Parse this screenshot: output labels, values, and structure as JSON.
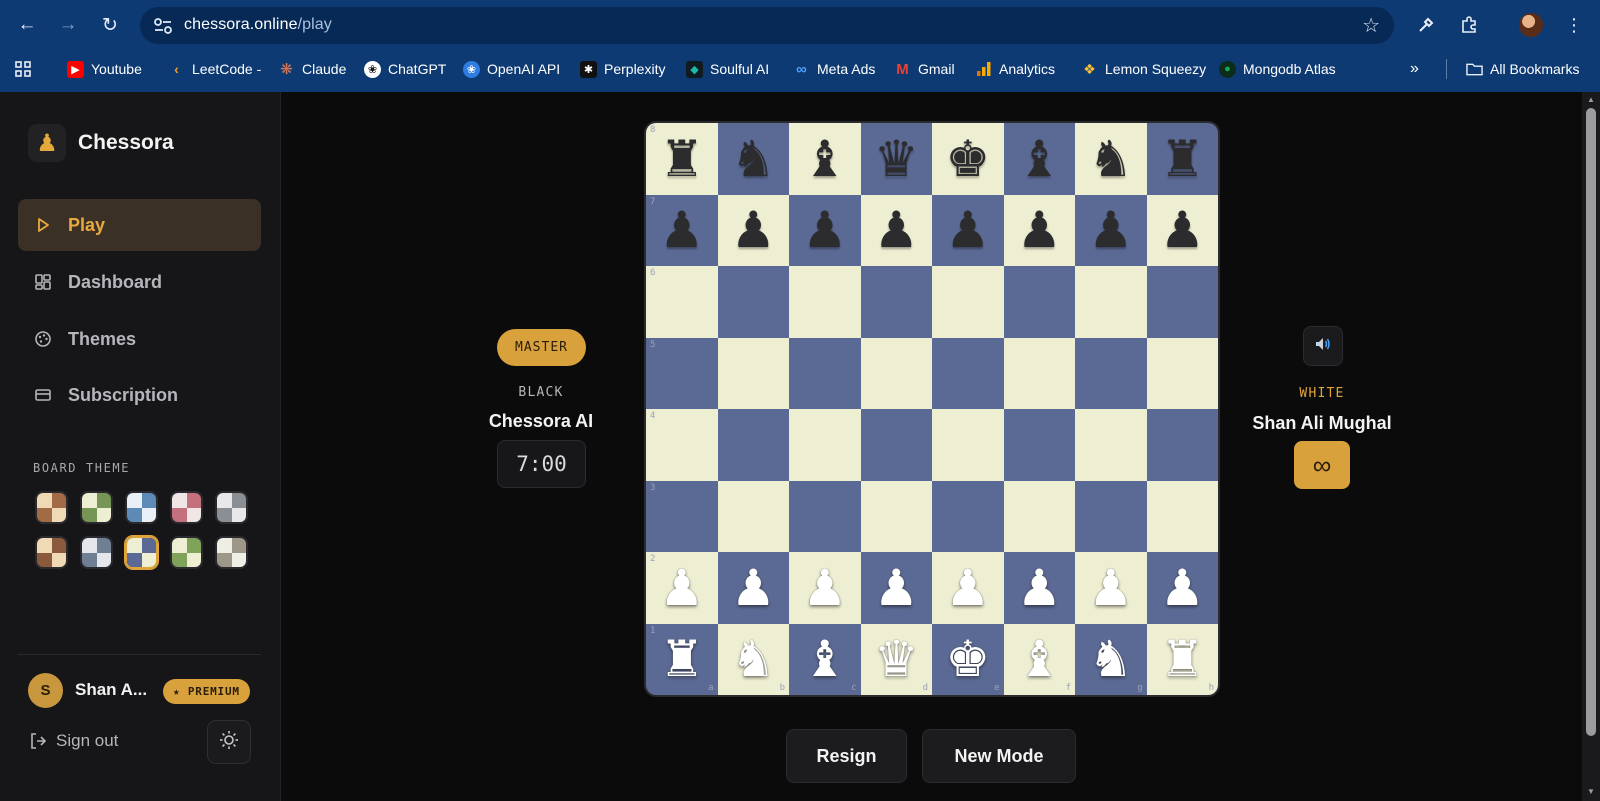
{
  "browser": {
    "url_host": "chessora.online",
    "url_path": "/play",
    "bookmarks": [
      {
        "label": "Youtube",
        "icon": "youtube-icon",
        "color": "#ff0000"
      },
      {
        "label": "LeetCode -",
        "icon": "leetcode-icon",
        "color": "#f89f1b"
      },
      {
        "label": "Claude",
        "icon": "claude-icon",
        "color": "#d97757"
      },
      {
        "label": "ChatGPT",
        "icon": "chatgpt-icon",
        "color": "#ffffff"
      },
      {
        "label": "OpenAI API",
        "icon": "openai-api-icon",
        "color": "#2f7de1"
      },
      {
        "label": "Perplexity",
        "icon": "perplexity-icon",
        "color": "#20808d"
      },
      {
        "label": "Soulful AI",
        "icon": "soulful-ai-icon",
        "color": "#1db9a6"
      },
      {
        "label": "Meta Ads",
        "icon": "meta-icon",
        "color": "#1877f2"
      },
      {
        "label": "Gmail",
        "icon": "gmail-icon",
        "color": "#ea4335"
      },
      {
        "label": "Analytics",
        "icon": "analytics-icon",
        "color": "#f9ab00"
      },
      {
        "label": "Lemon Squeezy",
        "icon": "lemon-squeezy-icon",
        "color": "#ffc233"
      },
      {
        "label": "Mongodb Atlas",
        "icon": "mongodb-icon",
        "color": "#13aa52"
      }
    ],
    "all_bookmarks_label": "All Bookmarks"
  },
  "sidebar": {
    "brand": "Chessora",
    "nav": [
      {
        "label": "Play",
        "icon": "play-icon",
        "active": true
      },
      {
        "label": "Dashboard",
        "icon": "dashboard-icon",
        "active": false
      },
      {
        "label": "Themes",
        "icon": "palette-icon",
        "active": false
      },
      {
        "label": "Subscription",
        "icon": "card-icon",
        "active": false
      }
    ],
    "board_theme_label": "BOARD THEME",
    "themes": [
      {
        "light": "#f0d9b5",
        "dark": "#a06b45"
      },
      {
        "light": "#eeeed2",
        "dark": "#769656"
      },
      {
        "light": "#eaf0f5",
        "dark": "#5e8ab8"
      },
      {
        "light": "#f1e6e6",
        "dark": "#c4707d"
      },
      {
        "light": "#e8e8e8",
        "dark": "#8a8f96"
      },
      {
        "light": "#f0d9b5",
        "dark": "#8b5a3c"
      },
      {
        "light": "#e3e6ea",
        "dark": "#6f7f94"
      },
      {
        "light": "#eeeed2",
        "dark": "#5b6a94",
        "selected": true
      },
      {
        "light": "#eeeed2",
        "dark": "#7fa35a"
      },
      {
        "light": "#eeeee4",
        "dark": "#9d9689"
      }
    ],
    "user": {
      "initial": "S",
      "name": "Shan A...",
      "badge": "★ PREMIUM"
    },
    "signout_label": "Sign out"
  },
  "game": {
    "opponent": {
      "level": "MASTER",
      "color_label": "BLACK",
      "name": "Chessora AI",
      "clock": "7:00"
    },
    "player": {
      "color_label": "WHITE",
      "name": "Shan Ali Mughal",
      "clock": "∞"
    },
    "board": {
      "light": "#eeeed2",
      "dark": "#5b6a94",
      "ranks": [
        "rnbqkbnr",
        "pppppppp",
        "........",
        "........",
        "........",
        "........",
        "PPPPPPPP",
        "RNBQKBNR"
      ],
      "rank_labels": [
        "8",
        "7",
        "6",
        "5",
        "4",
        "3",
        "2",
        "1"
      ],
      "file_labels": [
        "a",
        "b",
        "c",
        "d",
        "e",
        "f",
        "g",
        "h"
      ]
    },
    "actions": {
      "resign": "Resign",
      "new_mode": "New Mode"
    }
  }
}
